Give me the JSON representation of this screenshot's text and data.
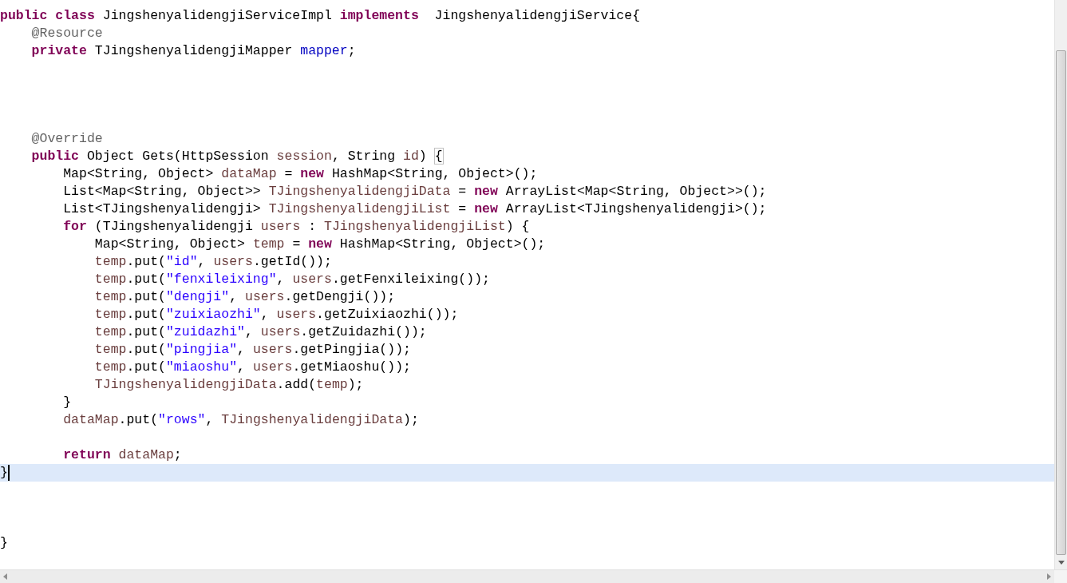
{
  "editor": {
    "lines": [
      {
        "current": false,
        "tokens": [
          {
            "kind": "keyword",
            "text": "public class"
          },
          {
            "kind": "plain",
            "text": " JingshenyalidengjiServiceImpl "
          },
          {
            "kind": "keyword",
            "text": "implements"
          },
          {
            "kind": "plain",
            "text": "  JingshenyalidengjiService{"
          }
        ]
      },
      {
        "current": false,
        "tokens": [
          {
            "kind": "annotation",
            "text": "    @Resource"
          }
        ]
      },
      {
        "current": false,
        "tokens": [
          {
            "kind": "keyword",
            "text": "    private"
          },
          {
            "kind": "plain",
            "text": " TJingshenyalidengjiMapper "
          },
          {
            "kind": "field",
            "text": "mapper"
          },
          {
            "kind": "plain",
            "text": ";"
          }
        ]
      },
      {
        "current": false
      },
      {
        "current": false
      },
      {
        "current": false
      },
      {
        "current": false
      },
      {
        "current": false,
        "tokens": [
          {
            "kind": "annotation",
            "text": "    @Override"
          }
        ]
      },
      {
        "current": false,
        "tokens": [
          {
            "kind": "keyword",
            "text": "    public"
          },
          {
            "kind": "plain",
            "text": " Object Gets(HttpSession "
          },
          {
            "kind": "local",
            "text": "session"
          },
          {
            "kind": "plain",
            "text": ", String "
          },
          {
            "kind": "local",
            "text": "id"
          },
          {
            "kind": "plain",
            "text": ") "
          },
          {
            "kind": "bracket",
            "text": "{"
          }
        ]
      },
      {
        "current": false,
        "tokens": [
          {
            "kind": "plain",
            "text": "        Map<String, Object> "
          },
          {
            "kind": "local",
            "text": "dataMap"
          },
          {
            "kind": "plain",
            "text": " = "
          },
          {
            "kind": "keyword",
            "text": "new"
          },
          {
            "kind": "plain",
            "text": " HashMap<String, Object>();"
          }
        ]
      },
      {
        "current": false,
        "tokens": [
          {
            "kind": "plain",
            "text": "        List<Map<String, Object>> "
          },
          {
            "kind": "local",
            "text": "TJingshenyalidengjiData"
          },
          {
            "kind": "plain",
            "text": " = "
          },
          {
            "kind": "keyword",
            "text": "new"
          },
          {
            "kind": "plain",
            "text": " ArrayList<Map<String, Object>>();"
          }
        ]
      },
      {
        "current": false,
        "tokens": [
          {
            "kind": "plain",
            "text": "        List<TJingshenyalidengji> "
          },
          {
            "kind": "local",
            "text": "TJingshenyalidengjiList"
          },
          {
            "kind": "plain",
            "text": " = "
          },
          {
            "kind": "keyword",
            "text": "new"
          },
          {
            "kind": "plain",
            "text": " ArrayList<TJingshenyalidengji>();"
          }
        ]
      },
      {
        "current": false,
        "tokens": [
          {
            "kind": "keyword",
            "text": "        for"
          },
          {
            "kind": "plain",
            "text": " (TJingshenyalidengji "
          },
          {
            "kind": "local",
            "text": "users"
          },
          {
            "kind": "plain",
            "text": " : "
          },
          {
            "kind": "local",
            "text": "TJingshenyalidengjiList"
          },
          {
            "kind": "plain",
            "text": ") {"
          }
        ]
      },
      {
        "current": false,
        "tokens": [
          {
            "kind": "plain",
            "text": "            Map<String, Object> "
          },
          {
            "kind": "local",
            "text": "temp"
          },
          {
            "kind": "plain",
            "text": " = "
          },
          {
            "kind": "keyword",
            "text": "new"
          },
          {
            "kind": "plain",
            "text": " HashMap<String, Object>();"
          }
        ]
      },
      {
        "current": false,
        "tokens": [
          {
            "kind": "local",
            "text": "            temp"
          },
          {
            "kind": "plain",
            "text": ".put("
          },
          {
            "kind": "string",
            "text": "\"id\""
          },
          {
            "kind": "plain",
            "text": ", "
          },
          {
            "kind": "local",
            "text": "users"
          },
          {
            "kind": "plain",
            "text": ".getId());"
          }
        ]
      },
      {
        "current": false,
        "tokens": [
          {
            "kind": "local",
            "text": "            temp"
          },
          {
            "kind": "plain",
            "text": ".put("
          },
          {
            "kind": "string",
            "text": "\"fenxileixing\""
          },
          {
            "kind": "plain",
            "text": ", "
          },
          {
            "kind": "local",
            "text": "users"
          },
          {
            "kind": "plain",
            "text": ".getFenxileixing());"
          }
        ]
      },
      {
        "current": false,
        "tokens": [
          {
            "kind": "local",
            "text": "            temp"
          },
          {
            "kind": "plain",
            "text": ".put("
          },
          {
            "kind": "string",
            "text": "\"dengji\""
          },
          {
            "kind": "plain",
            "text": ", "
          },
          {
            "kind": "local",
            "text": "users"
          },
          {
            "kind": "plain",
            "text": ".getDengji());"
          }
        ]
      },
      {
        "current": false,
        "tokens": [
          {
            "kind": "local",
            "text": "            temp"
          },
          {
            "kind": "plain",
            "text": ".put("
          },
          {
            "kind": "string",
            "text": "\"zuixiaozhi\""
          },
          {
            "kind": "plain",
            "text": ", "
          },
          {
            "kind": "local",
            "text": "users"
          },
          {
            "kind": "plain",
            "text": ".getZuixiaozhi());"
          }
        ]
      },
      {
        "current": false,
        "tokens": [
          {
            "kind": "local",
            "text": "            temp"
          },
          {
            "kind": "plain",
            "text": ".put("
          },
          {
            "kind": "string",
            "text": "\"zuidazhi\""
          },
          {
            "kind": "plain",
            "text": ", "
          },
          {
            "kind": "local",
            "text": "users"
          },
          {
            "kind": "plain",
            "text": ".getZuidazhi());"
          }
        ]
      },
      {
        "current": false,
        "tokens": [
          {
            "kind": "local",
            "text": "            temp"
          },
          {
            "kind": "plain",
            "text": ".put("
          },
          {
            "kind": "string",
            "text": "\"pingjia\""
          },
          {
            "kind": "plain",
            "text": ", "
          },
          {
            "kind": "local",
            "text": "users"
          },
          {
            "kind": "plain",
            "text": ".getPingjia());"
          }
        ]
      },
      {
        "current": false,
        "tokens": [
          {
            "kind": "local",
            "text": "            temp"
          },
          {
            "kind": "plain",
            "text": ".put("
          },
          {
            "kind": "string",
            "text": "\"miaoshu\""
          },
          {
            "kind": "plain",
            "text": ", "
          },
          {
            "kind": "local",
            "text": "users"
          },
          {
            "kind": "plain",
            "text": ".getMiaoshu());"
          }
        ]
      },
      {
        "current": false,
        "tokens": [
          {
            "kind": "local",
            "text": "            TJingshenyalidengjiData"
          },
          {
            "kind": "plain",
            "text": ".add("
          },
          {
            "kind": "local",
            "text": "temp"
          },
          {
            "kind": "plain",
            "text": ");"
          }
        ]
      },
      {
        "current": false,
        "tokens": [
          {
            "kind": "plain",
            "text": "        }"
          }
        ]
      },
      {
        "current": false,
        "tokens": [
          {
            "kind": "local",
            "text": "        dataMap"
          },
          {
            "kind": "plain",
            "text": ".put("
          },
          {
            "kind": "string",
            "text": "\"rows\""
          },
          {
            "kind": "plain",
            "text": ", "
          },
          {
            "kind": "local",
            "text": "TJingshenyalidengjiData"
          },
          {
            "kind": "plain",
            "text": ");"
          }
        ]
      },
      {
        "current": false
      },
      {
        "current": false,
        "tokens": [
          {
            "kind": "keyword",
            "text": "        return"
          },
          {
            "kind": "local",
            "text": " dataMap"
          },
          {
            "kind": "plain",
            "text": ";"
          }
        ]
      },
      {
        "current": true,
        "tokens": [
          {
            "kind": "plain",
            "text": "}"
          }
        ]
      },
      {
        "current": false
      },
      {
        "current": false
      },
      {
        "current": false
      },
      {
        "current": false,
        "tokens": [
          {
            "kind": "plain",
            "text": "}"
          }
        ]
      }
    ]
  }
}
